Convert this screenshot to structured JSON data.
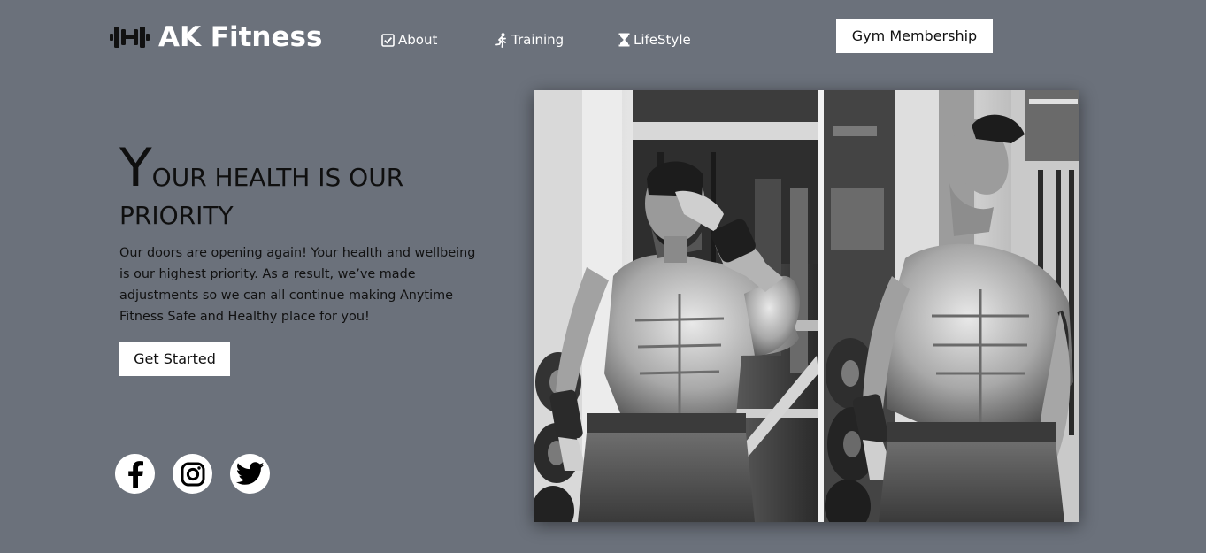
{
  "header": {
    "logo_text": "AK Fitness",
    "logo_icon": "dumbbell-icon",
    "nav": [
      {
        "label": "About",
        "icon": "checkbox-icon"
      },
      {
        "label": "Training",
        "icon": "running-icon"
      },
      {
        "label": "LifeStyle",
        "icon": "hourglass-icon"
      }
    ],
    "cta_label": "Gym Membership"
  },
  "hero": {
    "heading_first_letter": "Y",
    "heading_rest": "our health is our priority",
    "paragraph": "Our doors are opening again! Your health and wellbeing is our highest priority. As a result, we’ve made adjustments so we can all continue making Anytime Fitness Safe and Healthy place for you!",
    "button_label": "Get Started",
    "photo_icon": "gym-photo"
  },
  "social": [
    {
      "name": "facebook",
      "icon": "facebook-icon"
    },
    {
      "name": "instagram",
      "icon": "instagram-icon"
    },
    {
      "name": "twitter",
      "icon": "twitter-icon"
    }
  ],
  "colors": {
    "background": "#6b717b",
    "header_text": "#ffffff",
    "button_bg": "#ffffff",
    "body_text": "#111111"
  }
}
